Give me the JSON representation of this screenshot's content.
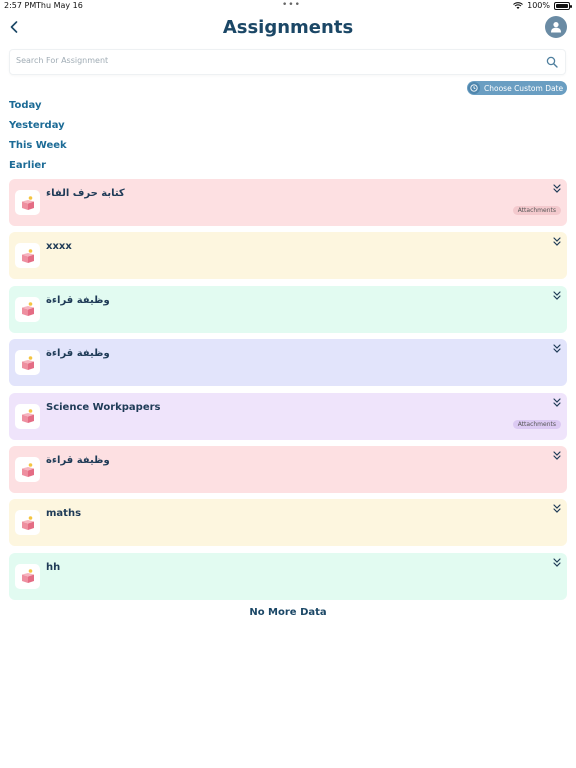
{
  "status_bar": {
    "time": "2:57 PM",
    "date": "Thu May 16",
    "dots": "•••",
    "battery": "100%",
    "battery_level": 1.0
  },
  "header": {
    "title": "Assignments",
    "back_icon": "chevron-left-icon",
    "avatar_icon": "person-icon"
  },
  "search": {
    "placeholder": "Search For Assignment",
    "value": ""
  },
  "date_filter": {
    "label": "Choose Custom Date",
    "icon": "clock-icon"
  },
  "filters": [
    "Today",
    "Yesterday",
    "This Week",
    "Earlier"
  ],
  "assignments": [
    {
      "title": "كتابة حرف الفاء",
      "color": "#fde0e2",
      "badge": "Attachments",
      "badge_color": "#f3c9cd"
    },
    {
      "title": "xxxx",
      "color": "#fdf6df",
      "badge": "",
      "badge_color": ""
    },
    {
      "title": "وظيفة قراءة",
      "color": "#e2fbf1",
      "badge": "",
      "badge_color": ""
    },
    {
      "title": "وظيفة قراءة",
      "color": "#e2e4fb",
      "badge": "",
      "badge_color": ""
    },
    {
      "title": "Science Workpapers",
      "color": "#efe4fb",
      "badge": "Attachments",
      "badge_color": "#dccaf3"
    },
    {
      "title": "وظيفة قراءة",
      "color": "#fde0e2",
      "badge": "",
      "badge_color": ""
    },
    {
      "title": "maths",
      "color": "#fdf6df",
      "badge": "",
      "badge_color": ""
    },
    {
      "title": "hh",
      "color": "#e2fbf1",
      "badge": "",
      "badge_color": ""
    }
  ],
  "footer": {
    "no_more": "No More Data"
  },
  "colors": {
    "title": "#1b4766",
    "filter_text": "#1c6b96",
    "date_button": "#6a9ec2",
    "avatar": "#6a8ba4"
  }
}
